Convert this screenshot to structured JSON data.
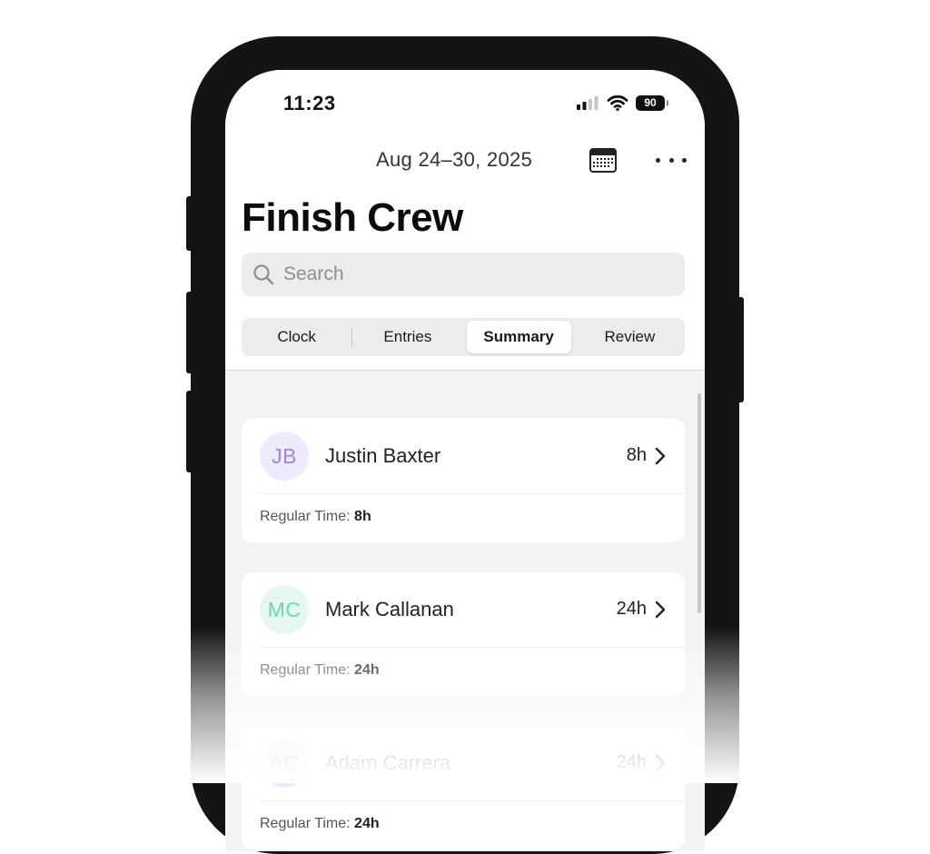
{
  "status_bar": {
    "time": "11:23",
    "battery": "90"
  },
  "header": {
    "date_range": "Aug 24–30, 2025",
    "title": "Finish Crew"
  },
  "search": {
    "placeholder": "Search",
    "value": ""
  },
  "tabs": [
    {
      "label": "Clock",
      "active": false
    },
    {
      "label": "Entries",
      "active": false
    },
    {
      "label": "Summary",
      "active": true
    },
    {
      "label": "Review",
      "active": false
    }
  ],
  "employees": [
    {
      "initials": "JB",
      "name": "Justin Baxter",
      "total": "8h",
      "regular_label": "Regular Time:",
      "regular_value": "8h",
      "avatar_bg": "#efeafd",
      "avatar_fg": "#9b86e6"
    },
    {
      "initials": "MC",
      "name": "Mark Callanan",
      "total": "24h",
      "regular_label": "Regular Time:",
      "regular_value": "24h",
      "avatar_bg": "#e5f8ef",
      "avatar_fg": "#72d6a9"
    },
    {
      "initials": "AC",
      "name": "Adam Carrera",
      "total": "24h",
      "regular_label": "Regular Time:",
      "regular_value": "24h",
      "avatar_bg": "#efeafd",
      "avatar_fg": "#9b86e6"
    }
  ],
  "icons": {
    "signal": "cellular-signal-icon",
    "wifi": "wifi-icon",
    "battery": "battery-icon",
    "calendar": "calendar-icon",
    "more": "more-icon",
    "search": "search-icon",
    "chevron": "chevron-right-icon"
  }
}
